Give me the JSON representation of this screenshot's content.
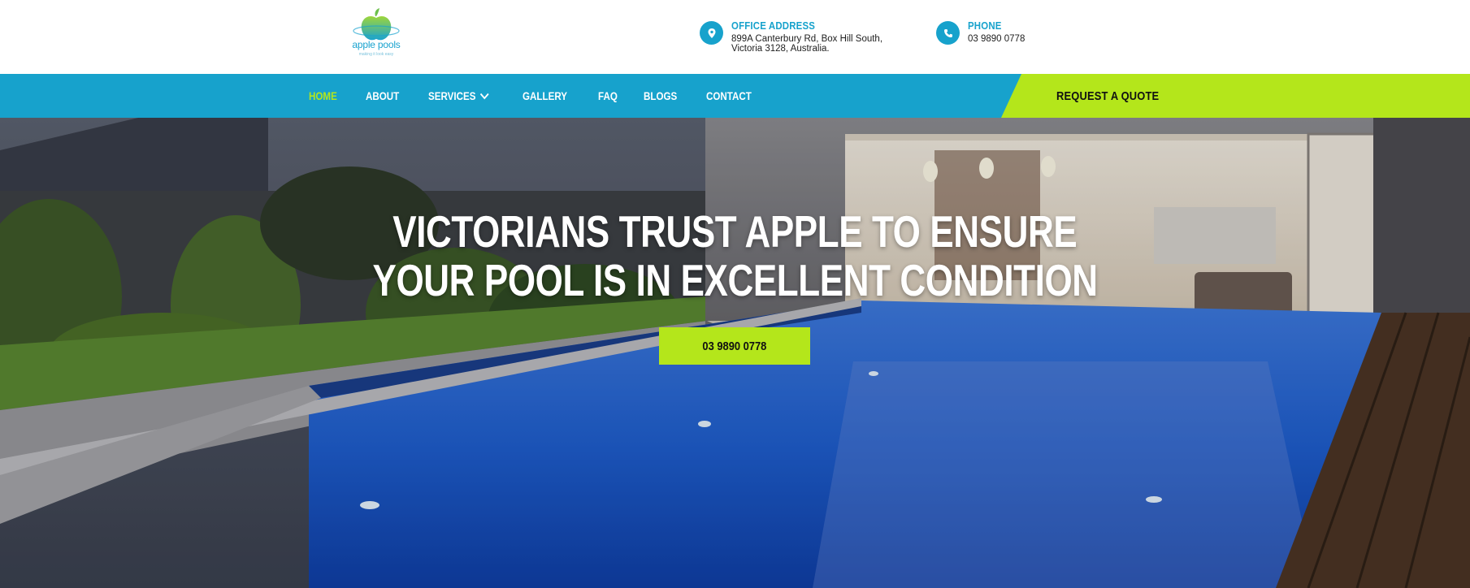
{
  "brand": {
    "name": "apple pools",
    "tagline": "making it look easy",
    "colors": {
      "primary": "#17a2cc",
      "accent": "#b4e61b"
    }
  },
  "header": {
    "address": {
      "icon": "location-pin-icon",
      "title": "OFFICE ADDRESS",
      "line1": "899A Canterbury Rd, Box Hill South,",
      "line2": "Victoria 3128, Australia."
    },
    "phone": {
      "icon": "phone-icon",
      "title": "PHONE",
      "number": "03 9890 0778"
    }
  },
  "nav": {
    "items": [
      {
        "label": "HOME",
        "active": true
      },
      {
        "label": "ABOUT"
      },
      {
        "label": "SERVICES",
        "has_dropdown": true
      },
      {
        "label": "GALLERY"
      },
      {
        "label": "FAQ"
      },
      {
        "label": "BLOGS"
      },
      {
        "label": "CONTACT"
      }
    ],
    "quote_label": "REQUEST A QUOTE"
  },
  "hero": {
    "title_line1": "VICTORIANS TRUST APPLE TO ENSURE",
    "title_line2": "YOUR POOL IS IN EXCELLENT CONDITION",
    "button_label": "03 9890 0778"
  }
}
